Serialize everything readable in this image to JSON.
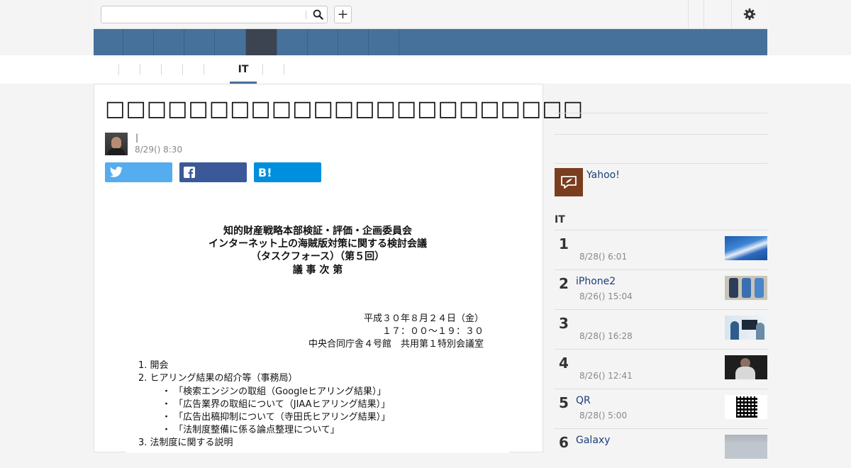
{
  "search": {
    "value": "",
    "placeholder": ""
  },
  "header": {
    "icons": [
      "search-icon",
      "plus-icon",
      "gear-icon"
    ]
  },
  "nav": {
    "item_count": 10,
    "active_index": 5
  },
  "subnav": {
    "active_label": "IT"
  },
  "article": {
    "title": "□□□□□□□□□□□□□□□□□□□□□□□",
    "author_separator": "|",
    "date": "8/29() 8:30",
    "share": {
      "twitter_icon": "twitter-icon",
      "facebook_icon": "facebook-icon",
      "hatena_label": "B!"
    }
  },
  "document": {
    "heading": [
      "知的財産戦略本部検証・評価・企画委員会",
      "インターネット上の海賊版対策に関する検討会議",
      "（タスクフォース）（第５回）",
      "議 事 次 第"
    ],
    "meta": [
      "平成３０年８月２４日（金）",
      "１７：００〜１９：３０",
      "中央合同庁舎４号館　共用第１特別会議室"
    ],
    "agenda": [
      "1. 開会",
      "2. ヒアリング結果の紹介等（事務局）",
      "「検索エンジンの取組（Googleヒアリング結果）」",
      "「広告業界の取組について（JIAAヒアリング結果）」",
      "「広告出稿抑制について（寺田氏ヒアリング結果）」",
      "「法制度整備に係る論点整理について」",
      "3. 法制度に関する説明"
    ]
  },
  "sidebar": {
    "yahoo_label": "Yahoo!",
    "ranking_heading": "IT",
    "ranking": [
      {
        "rank": "1",
        "title": "",
        "date": "8/28() 6:01"
      },
      {
        "rank": "2",
        "title": "iPhone2",
        "date": "8/26() 15:04"
      },
      {
        "rank": "3",
        "title": "",
        "date": "8/28() 16:28"
      },
      {
        "rank": "4",
        "title": "",
        "date": "8/26() 12:41"
      },
      {
        "rank": "5",
        "title": "QR",
        "date": "8/28() 5:00"
      },
      {
        "rank": "6",
        "title": "Galaxy",
        "date": ""
      }
    ]
  },
  "colors": {
    "nav_bg": "#46719a",
    "nav_active": "#3c4452",
    "twitter": "#55acee",
    "facebook": "#3b5998",
    "hatena": "#008fde",
    "link": "#1a3e7a"
  }
}
